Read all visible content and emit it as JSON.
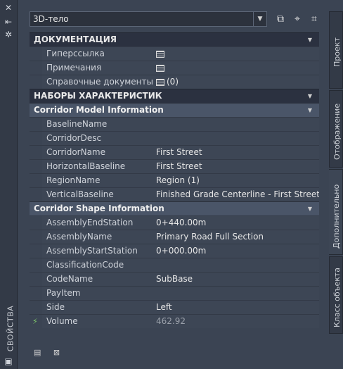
{
  "palette": {
    "title": "СВОЙСТВА"
  },
  "toolbar": {
    "selected": "3D-тело"
  },
  "categories": {
    "documentation": "ДОКУМЕНТАЦИЯ",
    "property_sets": "НАБОРЫ ХАРАКТЕРИСТИК"
  },
  "documentation_rows": [
    {
      "name": "Гиперссылка",
      "value": ""
    },
    {
      "name": "Примечания",
      "value": ""
    },
    {
      "name": "Справочные документы",
      "value": "(0)"
    }
  ],
  "corridor_model": {
    "title": "Corridor Model Information",
    "rows": [
      {
        "name": "BaselineName",
        "value": ""
      },
      {
        "name": "CorridorDesc",
        "value": ""
      },
      {
        "name": "CorridorName",
        "value": "First Street"
      },
      {
        "name": "HorizontalBaseline",
        "value": "First Street"
      },
      {
        "name": "RegionName",
        "value": "Region (1)"
      },
      {
        "name": "VerticalBaseline",
        "value": "Finished Grade Centerline - First Street"
      }
    ]
  },
  "corridor_shape": {
    "title": "Corridor Shape Information",
    "rows": [
      {
        "name": "AssemblyEndStation",
        "value": "0+440.00m"
      },
      {
        "name": "AssemblyName",
        "value": "Primary Road Full Section"
      },
      {
        "name": "AssemblyStartStation",
        "value": "0+000.00m"
      },
      {
        "name": "ClassificationCode",
        "value": ""
      },
      {
        "name": "CodeName",
        "value": "SubBase"
      },
      {
        "name": "PayItem",
        "value": ""
      },
      {
        "name": "Side",
        "value": "Left"
      },
      {
        "name": "Volume",
        "value": "462.92"
      }
    ]
  },
  "tabs": [
    "Проект",
    "Отображение",
    "Дополнительно",
    "Класс объекта"
  ],
  "icons": {
    "close": "close-icon",
    "autohide": "autohide-icon",
    "settings": "settings-icon",
    "table": "table-icon",
    "volume": "volume-icon"
  },
  "colors": {
    "panel": "#3b4453",
    "header": "#2b3140",
    "subheader": "#4a5568"
  }
}
